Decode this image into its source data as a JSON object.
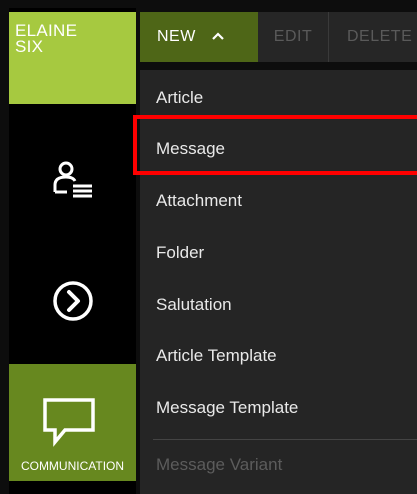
{
  "user": {
    "line1": "ELAINE",
    "line2": "SIX"
  },
  "rail": {
    "contacts_icon": "contact-list-icon",
    "forward_icon": "chevron-right-circle-icon",
    "communication_label": "COMMUNICATION",
    "communication_icon": "speech-bubble-icon"
  },
  "toolbar": {
    "new_label": "NEW",
    "new_icon": "chevron-up-icon",
    "edit_label": "EDIT",
    "delete_label": "DELETE"
  },
  "menu": {
    "items": [
      {
        "label": "Article",
        "enabled": true
      },
      {
        "label": "Message",
        "enabled": true,
        "highlighted": true
      },
      {
        "label": "Attachment",
        "enabled": true
      },
      {
        "label": "Folder",
        "enabled": true
      },
      {
        "label": "Salutation",
        "enabled": true
      },
      {
        "label": "Article Template",
        "enabled": true
      },
      {
        "label": "Message Template",
        "enabled": true
      },
      {
        "label": "Message Variant",
        "enabled": false
      }
    ]
  },
  "colors": {
    "accent_light": "#a6c940",
    "accent_dark": "#67881f",
    "new_button": "#4e6617",
    "menu_bg": "#252525",
    "highlight": "#ff0000"
  }
}
